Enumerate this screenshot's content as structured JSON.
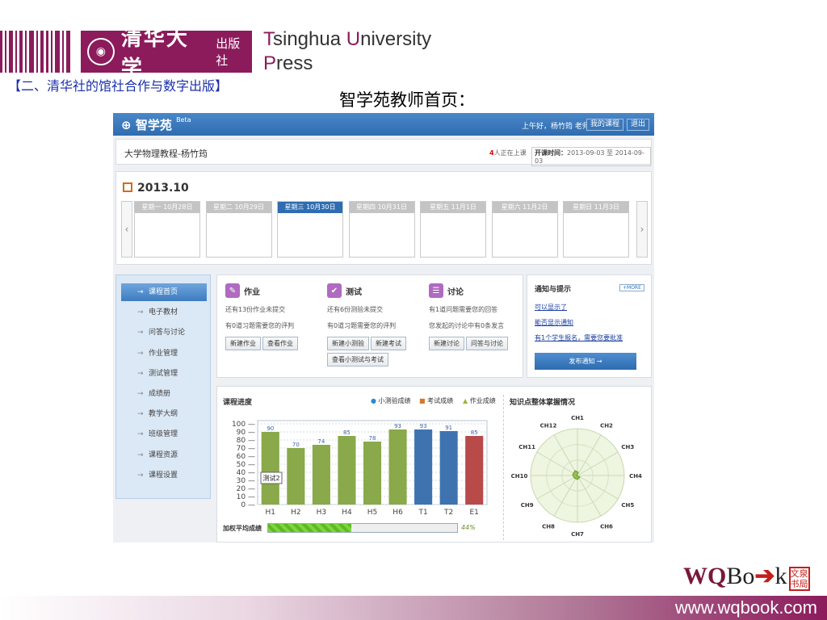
{
  "header": {
    "publisher_cn": "清华大学",
    "publisher_cn_suffix": "出版社",
    "press_line1_initial": "T",
    "press_line1_rest": "singhua ",
    "press_line1_initial2": "U",
    "press_line1_rest2": "niversity",
    "press_line2_initial": "P",
    "press_line2_rest": "ress",
    "section_title": "【二、清华社的馆社合作与数字出版】",
    "page_heading": "智学苑教师首页："
  },
  "app": {
    "logo": "智学苑",
    "beta": "Beta",
    "greeting": "上午好，杨竹筠 老师",
    "my_courses_button": "我的课程",
    "logout_button": "退出",
    "course_name": "大学物理教程-杨竹筠",
    "online_count": "4",
    "online_suffix": "人正在上课",
    "period_label": "开课时间：",
    "period_value": "2013-09-03 至 2014-09-03"
  },
  "calendar": {
    "month": "2013.10",
    "prev": "‹",
    "next": "›",
    "days": [
      {
        "label": "星期一 10月28日",
        "active": false
      },
      {
        "label": "星期二 10月29日",
        "active": false
      },
      {
        "label": "星期三 10月30日",
        "active": true
      },
      {
        "label": "星期四 10月31日",
        "active": false
      },
      {
        "label": "星期五 11月1日",
        "active": false
      },
      {
        "label": "星期六 11月2日",
        "active": false
      },
      {
        "label": "星期日 11月3日",
        "active": false
      }
    ]
  },
  "sidebar": {
    "items": [
      {
        "label": "课程首页",
        "active": true
      },
      {
        "label": "电子教材",
        "active": false
      },
      {
        "label": "问答与讨论",
        "active": false
      },
      {
        "label": "作业管理",
        "active": false
      },
      {
        "label": "测试管理",
        "active": false
      },
      {
        "label": "成绩册",
        "active": false
      },
      {
        "label": "教学大纲",
        "active": false
      },
      {
        "label": "班级管理",
        "active": false
      },
      {
        "label": "课程资源",
        "active": false
      },
      {
        "label": "课程设置",
        "active": false
      }
    ]
  },
  "tasks": {
    "homework": {
      "title": "作业",
      "line1": "还有13份作业未提交",
      "line2": "有0道习题需要您的评判",
      "buttons": [
        "新建作业",
        "查看作业"
      ]
    },
    "test": {
      "title": "测试",
      "line1": "还有6份测验未提交",
      "line2": "有0道习题需要您的评判",
      "buttons": [
        "新建小测验",
        "新建考试"
      ],
      "extra_button": "查看小测试与考试"
    },
    "discussion": {
      "title": "讨论",
      "line1": "有1道问题需要您的回答",
      "line2": "您发起的讨论中有0条发言",
      "buttons": [
        "新建讨论",
        "问答与讨论"
      ]
    }
  },
  "notice": {
    "title": "通知与提示",
    "more": "+MORE",
    "links": [
      "可以显示了",
      "能否显示通知",
      "有1个学生报名，需要您要批准"
    ],
    "publish_button": "发布通知 →"
  },
  "progress": {
    "title": "课程进度",
    "legend": [
      "小测验成绩",
      "考试成绩",
      "作业成绩"
    ],
    "tooltip": "测试2",
    "avg_label": "加权平均成绩",
    "avg_value": 44,
    "avg_text": "44%"
  },
  "chart_data": {
    "type": "bar",
    "categories": [
      "H1",
      "H2",
      "H3",
      "H4",
      "H5",
      "H6",
      "T1",
      "T2",
      "E1"
    ],
    "values": [
      90,
      70,
      74,
      85,
      78,
      93,
      93,
      91,
      85
    ],
    "kinds": [
      "作业成绩",
      "作业成绩",
      "作业成绩",
      "作业成绩",
      "作业成绩",
      "作业成绩",
      "小测验成绩",
      "小测验成绩",
      "考试成绩"
    ],
    "ylim": [
      0,
      100
    ],
    "yticks": [
      0,
      10,
      20,
      30,
      40,
      50,
      60,
      70,
      80,
      90,
      100
    ],
    "colors": {
      "小测验成绩": "#3f73b0",
      "考试成绩": "#b84a4a",
      "作业成绩": "#89a94a"
    },
    "legend_colors": {
      "小测验成绩": "#2a8ad0",
      "考试成绩": "#d8782a",
      "作业成绩": "#99b83a"
    }
  },
  "radar": {
    "title": "知识点整体掌握情况",
    "axes": [
      "CH1",
      "CH2",
      "CH3",
      "CH4",
      "CH5",
      "CH6",
      "CH7",
      "CH8",
      "CH9",
      "CH10",
      "CH11",
      "CH12"
    ]
  },
  "branding": {
    "wq": "WQ",
    "bo": "Bo",
    "k": "k",
    "seal_text": "文泉书局",
    "url": "www.wqbook.com"
  }
}
